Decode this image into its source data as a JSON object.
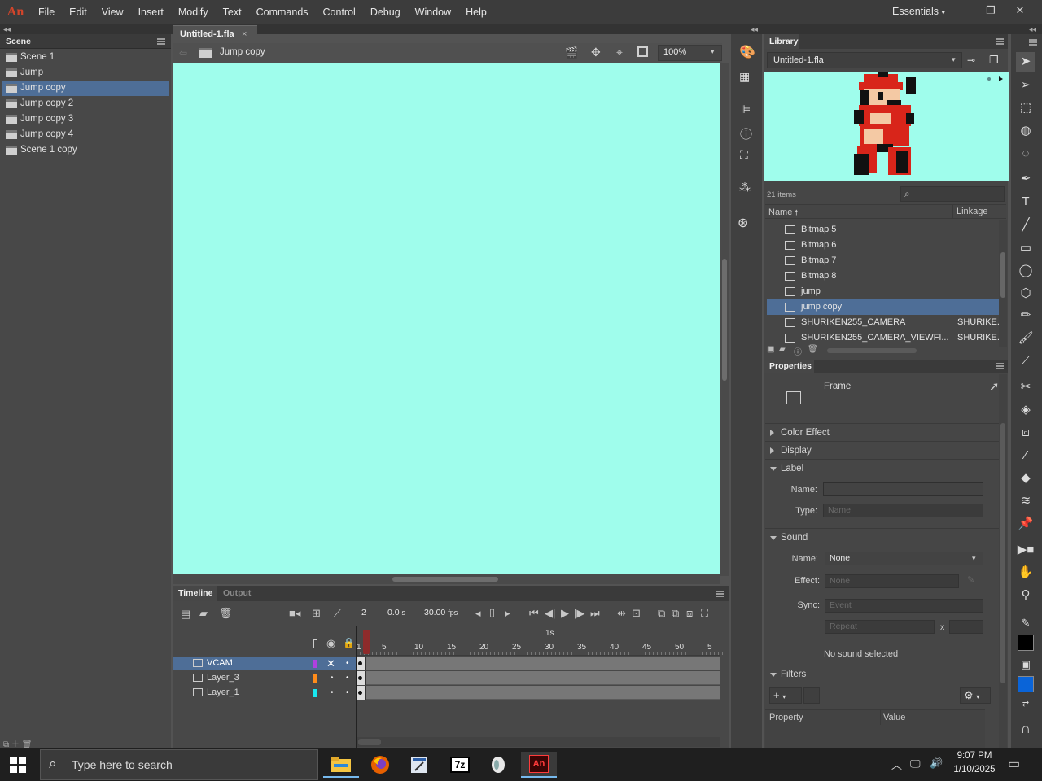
{
  "app": {
    "logo": "An",
    "menu": [
      "File",
      "Edit",
      "View",
      "Insert",
      "Modify",
      "Text",
      "Commands",
      "Control",
      "Debug",
      "Window",
      "Help"
    ],
    "workspace": "Essentials"
  },
  "scene_panel": {
    "title": "Scene",
    "items": [
      {
        "label": "Scene 1",
        "selected": false
      },
      {
        "label": "Jump",
        "selected": false
      },
      {
        "label": "Jump copy",
        "selected": true
      },
      {
        "label": "Jump copy 2",
        "selected": false
      },
      {
        "label": "Jump copy 3",
        "selected": false
      },
      {
        "label": "Jump copy 4",
        "selected": false
      },
      {
        "label": "Scene 1 copy",
        "selected": false
      }
    ]
  },
  "document": {
    "tab": "Untitled-1.fla",
    "tab_close": "×",
    "scene_name": "Jump copy",
    "zoom": "100%",
    "stage_color": "#9ffdec"
  },
  "timeline": {
    "tab_timeline": "Timeline",
    "tab_output": "Output",
    "current_frame": "2",
    "time": "0.0",
    "time_unit": "s",
    "fps": "30.00",
    "fps_unit": "fps",
    "second_marker": "1s",
    "frame_numbers": [
      "1",
      "5",
      "10",
      "15",
      "20",
      "25",
      "30",
      "35",
      "40",
      "45",
      "50",
      "5"
    ],
    "layers": [
      {
        "name": "VCAM",
        "color": "#b040e0",
        "selected": true
      },
      {
        "name": "Layer_3",
        "color": "#ff8c1a",
        "selected": false
      },
      {
        "name": "Layer_1",
        "color": "#18e8f0",
        "selected": false
      }
    ]
  },
  "library": {
    "title": "Library",
    "document": "Untitled-1.fla",
    "item_count": "21 items",
    "col_name": "Name",
    "col_linkage": "Linkage",
    "items": [
      {
        "name": "Bitmap 5",
        "type": "bitmap",
        "linkage": "",
        "selected": false
      },
      {
        "name": "Bitmap 6",
        "type": "bitmap",
        "linkage": "",
        "selected": false
      },
      {
        "name": "Bitmap 7",
        "type": "bitmap",
        "linkage": "",
        "selected": false
      },
      {
        "name": "Bitmap 8",
        "type": "bitmap",
        "linkage": "",
        "selected": false
      },
      {
        "name": "jump",
        "type": "symbol",
        "linkage": "",
        "selected": false
      },
      {
        "name": "jump copy",
        "type": "symbol",
        "linkage": "",
        "selected": true
      },
      {
        "name": "SHURIKEN255_CAMERA",
        "type": "symbol",
        "linkage": "SHURIKE.",
        "selected": false
      },
      {
        "name": "SHURIKEN255_CAMERA_VIEWFI...",
        "type": "symbol",
        "linkage": "SHURIKE.",
        "selected": false
      }
    ]
  },
  "properties": {
    "title": "Properties",
    "object_type": "Frame",
    "sections": {
      "color_effect": "Color Effect",
      "display": "Display",
      "label": "Label",
      "sound": "Sound",
      "filters": "Filters"
    },
    "label_name_label": "Name:",
    "label_type_label": "Type:",
    "label_type_value": "Name",
    "sound_name_label": "Name:",
    "sound_name_value": "None",
    "effect_label": "Effect:",
    "effect_value": "None",
    "sync_label": "Sync:",
    "sync_value": "Event",
    "repeat_value": "Repeat",
    "repeat_x": "x",
    "no_sound": "No sound selected",
    "col_property": "Property",
    "col_value": "Value"
  },
  "taskbar": {
    "search_placeholder": "Type here to search",
    "time": "9:07 PM",
    "date": "1/10/2025",
    "apps": [
      "file-explorer-icon",
      "firefox-icon",
      "editor-icon",
      "7zip-icon",
      "bird-app-icon",
      "animate-icon"
    ],
    "app_7z_label": "7z",
    "app_an_label": "An"
  }
}
